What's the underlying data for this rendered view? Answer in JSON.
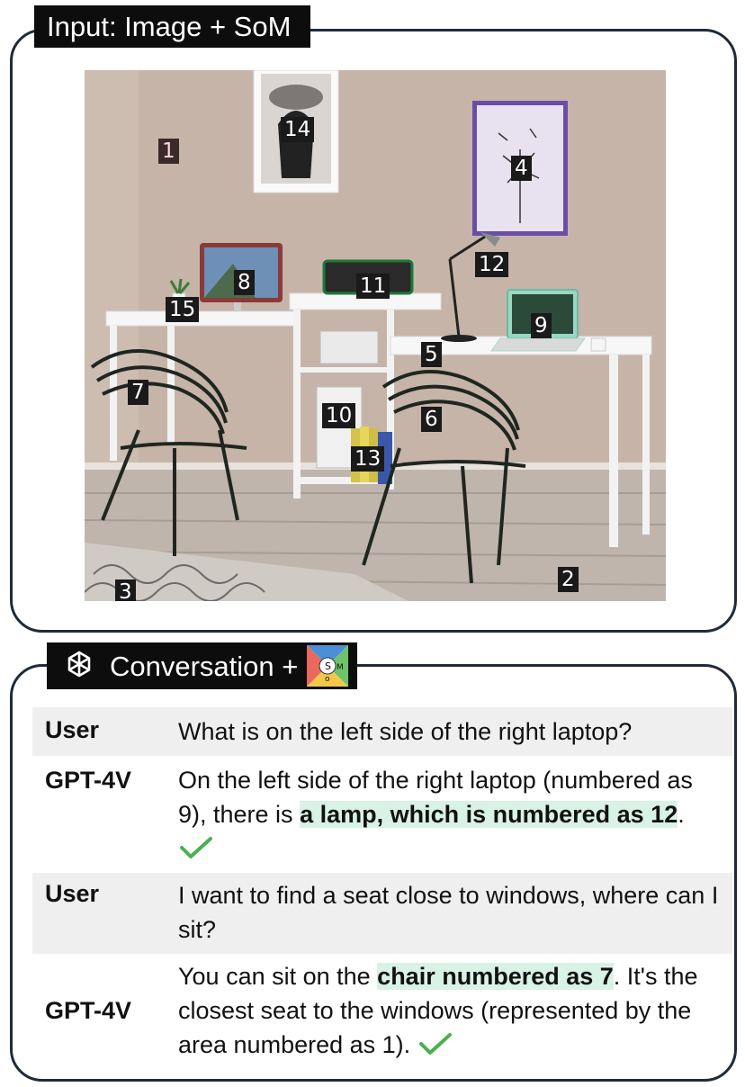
{
  "input_label": "Input: Image + SoM",
  "conversation_label": "Conversation +",
  "markers": {
    "m1": "1",
    "m2": "2",
    "m3": "3",
    "m4": "4",
    "m5": "5",
    "m6": "6",
    "m7": "7",
    "m8": "8",
    "m9": "9",
    "m10": "10",
    "m11": "11",
    "m12": "12",
    "m13": "13",
    "m14": "14",
    "m15": "15"
  },
  "som_logo_letters": [
    "S",
    "o",
    "M"
  ],
  "conversation": [
    {
      "speaker": "User",
      "message": "What is on the left side of the right laptop?"
    },
    {
      "speaker": "GPT-4V",
      "message_before": "On the left side of the right laptop (numbered as 9), there is ",
      "highlight": "a lamp, which is numbered as 12",
      "message_after": "."
    },
    {
      "speaker": "User",
      "message": "I want to find a seat close to windows, where can I sit?"
    },
    {
      "speaker": "GPT-4V",
      "message_before": "You can sit on the ",
      "highlight": "chair numbered as 7",
      "message_after": ". It's the closest seat to the windows (represented by the area numbered as 1)."
    }
  ],
  "colors": {
    "check": "#4caf50",
    "highlight": "#d9f2e6",
    "border": "#1f2b3a",
    "tab_bg": "#0d0d0d"
  }
}
